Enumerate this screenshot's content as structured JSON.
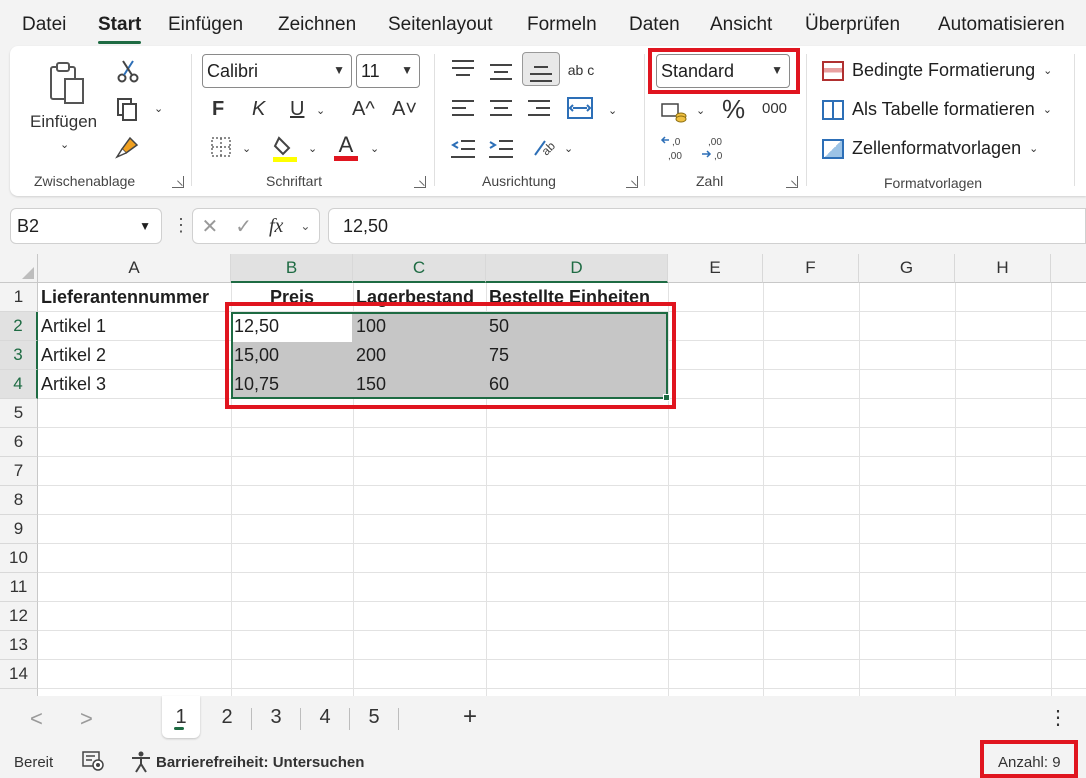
{
  "menu": {
    "tabs": [
      "Datei",
      "Start",
      "Einfügen",
      "Zeichnen",
      "Seitenlayout",
      "Formeln",
      "Daten",
      "Ansicht",
      "Überprüfen",
      "Automatisieren"
    ],
    "active": "Start"
  },
  "ribbon": {
    "clipboard": {
      "paste_label": "Einfügen",
      "group_label": "Zwischenablage"
    },
    "font": {
      "font_name": "Calibri",
      "font_size": "11",
      "bold": "F",
      "italic": "K",
      "underline": "U",
      "grow": "A^",
      "shrink": "A˅",
      "font_color_letter": "A",
      "group_label": "Schriftart",
      "highlight_color": "#ffff00",
      "font_color": "#e0151f"
    },
    "alignment": {
      "group_label": "Ausrichtung",
      "wrap_label": "ab c"
    },
    "number": {
      "format": "Standard",
      "percent": "%",
      "thousands": "000",
      "inc_decimal": "←,0 ,00",
      "dec_decimal": ",00 →,0",
      "group_label": "Zahl"
    },
    "styles": {
      "conditional": "Bedingte Formatierung",
      "as_table": "Als Tabelle formatieren",
      "cell_styles": "Zellenformatvorlagen",
      "group_label": "Formatvorlagen"
    }
  },
  "formula_bar": {
    "name_box": "B2",
    "fx": "fx",
    "value": "12,50"
  },
  "grid": {
    "columns": [
      "A",
      "B",
      "C",
      "D",
      "E",
      "F",
      "G",
      "H"
    ],
    "rows": [
      "1",
      "2",
      "3",
      "4",
      "5",
      "6",
      "7",
      "8",
      "9",
      "10",
      "11",
      "12",
      "13",
      "14"
    ],
    "header": [
      "Lieferantennummer",
      "Preis",
      "Lagerbestand",
      "Bestellte Einheiten"
    ],
    "data": [
      [
        "Artikel 1",
        "12,50",
        "100",
        "50"
      ],
      [
        "Artikel 2",
        "15,00",
        "200",
        "75"
      ],
      [
        "Artikel 3",
        "10,75",
        "150",
        "60"
      ]
    ],
    "accent": "#1e6b43",
    "highlight": "#e0151f"
  },
  "sheets": {
    "tabs": [
      "1",
      "2",
      "3",
      "4",
      "5"
    ],
    "active": "1",
    "add": "+",
    "more": "⋮",
    "prev": "<",
    "next": ">"
  },
  "status": {
    "ready": "Bereit",
    "accessibility": "Barrierefreiheit: Untersuchen",
    "count": "Anzahl: 9"
  }
}
